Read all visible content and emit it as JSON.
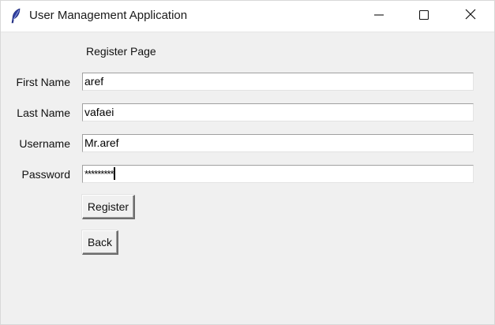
{
  "window": {
    "title": "User Management Application",
    "icon": "feather-icon",
    "controls": [
      "minimize-icon",
      "maximize-icon",
      "close-icon"
    ]
  },
  "page": {
    "heading": "Register Page"
  },
  "form": {
    "first_name": {
      "label": "First Name",
      "value": "aref"
    },
    "last_name": {
      "label": "Last Name",
      "value": "vafaei"
    },
    "username": {
      "label": "Username",
      "value": "Mr.aref"
    },
    "password": {
      "label": "Password",
      "value": "*********"
    }
  },
  "buttons": {
    "register": "Register",
    "back": "Back"
  },
  "colors": {
    "background": "#f0f0f0",
    "titlebar": "#ffffff",
    "field_bg": "#ffffff"
  }
}
